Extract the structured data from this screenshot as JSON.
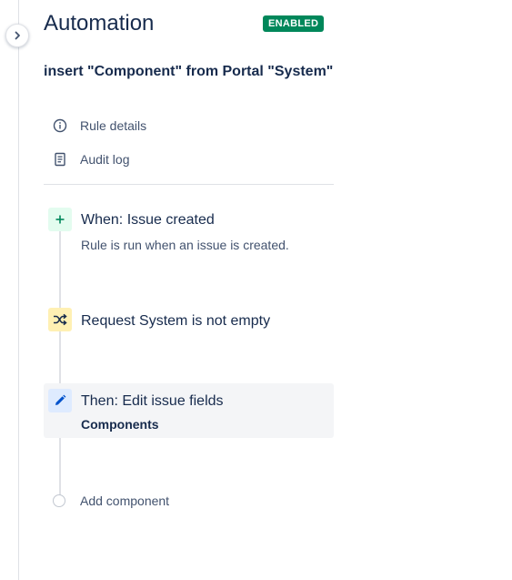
{
  "header": {
    "title": "Automation",
    "status_badge": "ENABLED"
  },
  "rule": {
    "name": "insert \"Component\" from Portal \"System\""
  },
  "menu": [
    {
      "label": "Rule details",
      "icon": "info-icon"
    },
    {
      "label": "Audit log",
      "icon": "document-icon"
    }
  ],
  "steps": {
    "trigger": {
      "title": "When: Issue created",
      "description": "Rule is run when an issue is created.",
      "icon": "plus-icon"
    },
    "condition": {
      "title": "Request System is not empty",
      "icon": "shuffle-icon"
    },
    "action": {
      "title": "Then: Edit issue fields",
      "detail": "Components",
      "icon": "pencil-icon"
    }
  },
  "add_component": {
    "label": "Add component"
  },
  "colors": {
    "text": "#172b4d",
    "subtle_text": "#42526e",
    "enabled_badge": "#00875a",
    "trigger_bg": "#e3fcef",
    "trigger_icon": "#00875a",
    "condition_bg": "#fff0b3",
    "action_bg": "#deebff",
    "action_icon": "#0052cc",
    "selected_row": "#f4f5f7",
    "border": "#dfe1e6"
  }
}
